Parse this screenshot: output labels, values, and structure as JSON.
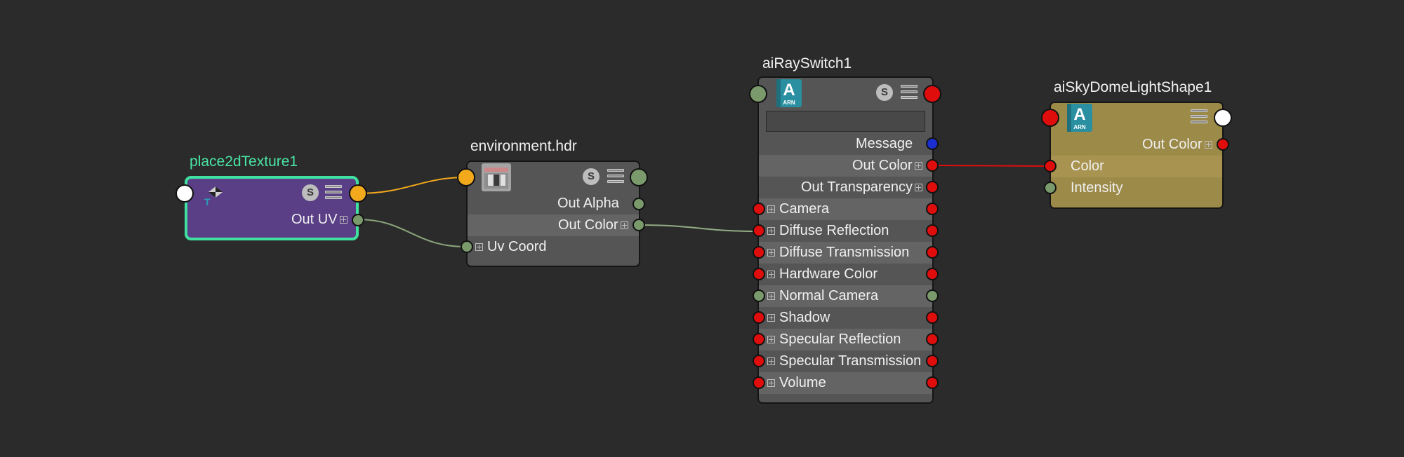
{
  "nodes": {
    "place2d": {
      "title": "place2dTexture1",
      "out_uv": "Out UV"
    },
    "env": {
      "title": "environment.hdr",
      "out_alpha": "Out Alpha",
      "out_color": "Out Color",
      "uv_coord": "Uv Coord"
    },
    "ray": {
      "title": "aiRaySwitch1",
      "icon_letter": "A",
      "icon_tag": "ARN",
      "message": "Message",
      "out_color": "Out Color",
      "out_transparency": "Out Transparency",
      "inputs": [
        "Camera",
        "Diffuse Reflection",
        "Diffuse Transmission",
        "Hardware Color",
        "Normal Camera",
        "Shadow",
        "Specular Reflection",
        "Specular Transmission",
        "Volume"
      ]
    },
    "sky": {
      "title": "aiSkyDomeLightShape1",
      "icon_letter": "A",
      "icon_tag": "ARN",
      "out_color": "Out Color",
      "color": "Color",
      "intensity": "Intensity"
    }
  },
  "s_label": "S",
  "colors": {
    "background": "#2b2b2b",
    "place2d_fill": "#5a3f86",
    "place2d_border": "#3fe0a0",
    "shader_fill": "#555555",
    "light_fill": "#9c8a48",
    "wire_uv": "#8aa37a",
    "wire_place": "#f2a91c",
    "wire_color": "#e00d0d",
    "wire_envcolor": "#93ad84"
  }
}
